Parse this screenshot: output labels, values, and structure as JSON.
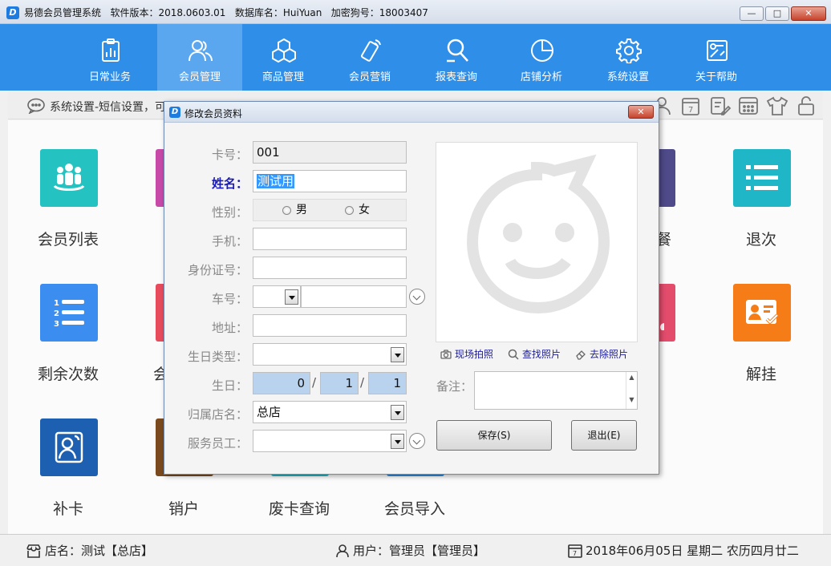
{
  "window": {
    "title": "易德会员管理系统   软件版本：2018.0603.01   数据库名：HuiYuan   加密狗号：18003407",
    "app_icon": "D",
    "minimize": "—",
    "maximize": "□",
    "close": "✕"
  },
  "nav": {
    "items": [
      {
        "label": "日常业务",
        "icon": "clipboard-chart-icon"
      },
      {
        "label": "会员管理",
        "icon": "users-icon",
        "active": true
      },
      {
        "label": "商品管理",
        "icon": "cubes-icon"
      },
      {
        "label": "会员营销",
        "icon": "phone-signal-icon"
      },
      {
        "label": "报表查询",
        "icon": "magnifier-report-icon"
      },
      {
        "label": "店铺分析",
        "icon": "pie-chart-icon"
      },
      {
        "label": "系统设置",
        "icon": "gear-icon"
      },
      {
        "label": "关于帮助",
        "icon": "help-icon"
      }
    ]
  },
  "breadcrumb": {
    "text": "系统设置-短信设置，可…"
  },
  "toolbar_icons": [
    "user-icon",
    "calendar-icon",
    "edit-icon",
    "calculator-icon",
    "shirt-icon",
    "lock-icon"
  ],
  "tiles": [
    {
      "label": "会员列表",
      "color": "#25c2c2",
      "icon": "group-icon"
    },
    {
      "label": "退次",
      "color": "#1fb6c8",
      "icon": "list-icon"
    },
    {
      "label": "剩余次数",
      "color": "#3b8df0",
      "icon": "numbered-list-icon"
    },
    {
      "label": "解挂",
      "color": "#f57c16",
      "icon": "id-card-check-icon"
    },
    {
      "label": "补卡",
      "color": "#1d5fb0",
      "icon": "portrait-icon"
    },
    {
      "label": "销户",
      "color": "#7a4a1e",
      "icon": "closed-icon"
    },
    {
      "label": "废卡查询",
      "color": "#20b8c8",
      "icon": "search-card-icon"
    },
    {
      "label": "会员导入",
      "color": "#2a8ee4",
      "icon": "import-icon"
    },
    {
      "label": "餐",
      "color": "#4f4a8a",
      "icon": "package-icon"
    },
    {
      "label": "会",
      "color": "#e44c6c",
      "icon": "member-icon"
    }
  ],
  "status": {
    "store": "店名：测试【总店】",
    "user": "用户：管理员【管理员】",
    "date": "2018年06月05日 星期二 农历四月廿二"
  },
  "dialog": {
    "title": "修改会员资料",
    "labels": {
      "card_no": "卡号：",
      "name": "姓名：",
      "gender": "性别：",
      "phone": "手机：",
      "id_no": "身份证号：",
      "car_no": "车号：",
      "address": "地址：",
      "birthday_type": "生日类型：",
      "birthday": "生日：",
      "store": "归属店名：",
      "staff": "服务员工：",
      "note": "备注："
    },
    "values": {
      "card_no": "001",
      "name": "测试用",
      "gender_male": "男",
      "gender_female": "女",
      "phone": "",
      "id_no": "",
      "car_prefix": "",
      "car_no": "",
      "address": "",
      "birthday_type": "",
      "birthday_year": "0",
      "birthday_month": "1",
      "birthday_day": "1",
      "sep": "/",
      "store": "总店",
      "staff": "",
      "note": ""
    },
    "photo_links": {
      "capture": "现场拍照",
      "find": "查找照片",
      "remove": "去除照片"
    },
    "buttons": {
      "save": "保存(S)",
      "exit": "退出(E)"
    }
  }
}
